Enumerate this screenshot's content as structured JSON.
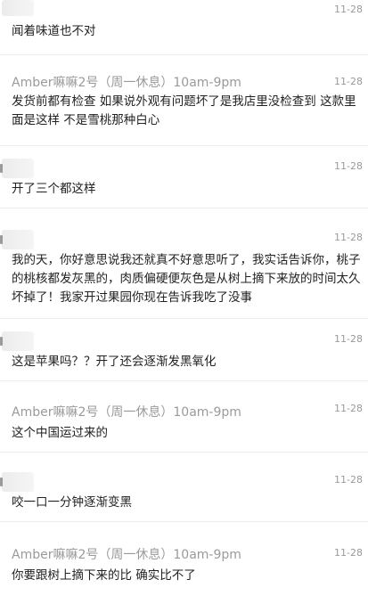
{
  "messages": [
    {
      "sender": "",
      "time": "11-28",
      "text": "闻着味道也不对"
    },
    {
      "sender": "Amber嘛嘛2号（周一休息）10am-9pm",
      "time": "11-28",
      "text": "发货前都有检查 如果说外观有问题坏了是我店里没检查到 这款里面是这样 不是雪桃那种白心"
    },
    {
      "sender": "",
      "time": "11-28",
      "text": "开了三个都这样"
    },
    {
      "sender": "",
      "time": "11-28",
      "text": "我的天，你好意思说我还就真不好意思听了，我实话告诉你，桃子的桃核都发灰黑的，肉质偏硬便灰色是从树上摘下来放的时间太久坏掉了！我家开过果园你现在告诉我吃了没事"
    },
    {
      "sender": "",
      "time": "11-28",
      "text": "这是苹果吗？？开了还会逐渐发黑氧化"
    },
    {
      "sender": "Amber嘛嘛2号（周一休息）10am-9pm",
      "time": "11-28",
      "text": "这个中国运过来的"
    },
    {
      "sender": "",
      "time": "11-28",
      "text": "咬一口一分钟逐渐变黑"
    },
    {
      "sender": "Amber嘛嘛2号（周一休息）10am-9pm",
      "time": "11-28",
      "text": "你要跟树上摘下来的比 确实比不了"
    }
  ]
}
